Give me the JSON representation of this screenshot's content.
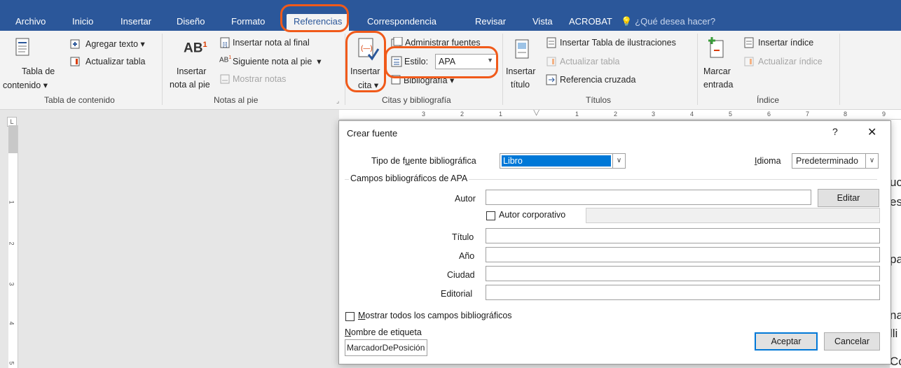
{
  "tabs": [
    "Archivo",
    "Inicio",
    "Insertar",
    "Diseño",
    "Formato",
    "Referencias",
    "Correspondencia",
    "Revisar",
    "Vista",
    "ACROBAT"
  ],
  "active_tab": "Referencias",
  "search": {
    "label": "¿Qué desea hacer?",
    "icon": "lightbulb-icon"
  },
  "ribbon": {
    "tabla_contenido": {
      "big_line1": "Tabla de",
      "big_line2": "contenido",
      "agregar_texto": "Agregar texto",
      "actualizar_tabla": "Actualizar tabla",
      "group_label": "Tabla de contenido"
    },
    "notas_pie": {
      "big_line1": "Insertar",
      "big_line2": "nota al pie",
      "insertar_nota_final": "Insertar nota al final",
      "siguiente_nota": "Siguiente nota al pie",
      "mostrar_notas": "Mostrar notas",
      "group_label": "Notas al pie"
    },
    "citas": {
      "big_line1": "Insertar",
      "big_line2": "cita",
      "administrar_fuentes": "Administrar fuentes",
      "estilo_label": "Estilo:",
      "estilo_value": "APA",
      "bibliografia": "Bibliografía",
      "group_label": "Citas y bibliografía"
    },
    "titulos": {
      "big_line1": "Insertar",
      "big_line2": "título",
      "insertar_tabla_ilustraciones": "Insertar Tabla de ilustraciones",
      "actualizar_tabla": "Actualizar tabla",
      "referencia_cruzada": "Referencia cruzada",
      "group_label": "Títulos"
    },
    "indice": {
      "big_line1": "Marcar",
      "big_line2": "entrada",
      "insertar_indice": "Insertar índice",
      "actualizar_indice": "Actualizar índice",
      "group_label": "Índice"
    }
  },
  "ruler": {
    "corner": "L",
    "h_ticks": [
      "3",
      "2",
      "1",
      "1",
      "2",
      "3",
      "4",
      "5",
      "6",
      "7",
      "8",
      "9"
    ],
    "v_ticks": [
      "1",
      "2",
      "3",
      "4",
      "5"
    ]
  },
  "page_fragments": [
    "uc",
    "es",
    "pa",
    "na",
    "lli",
    "Co"
  ],
  "dialog": {
    "title": "Crear fuente",
    "help": "?",
    "close": "✕",
    "tipo_label_pre": "Tipo de f",
    "tipo_label_u": "u",
    "tipo_label_post": "ente bibliográfica",
    "tipo_value": "Libro",
    "idioma_label_pre": "",
    "idioma_label_u": "I",
    "idioma_label_post": "dioma",
    "idioma_value": "Predeterminado",
    "section_title": "Campos bibliográficos de APA",
    "autor_label": "Autor",
    "editar_button": "Editar",
    "autor_corporativo": "Autor corporativo",
    "titulo_label": "Título",
    "anio_label": "Año",
    "ciudad_label": "Ciudad",
    "editorial_label": "Editorial",
    "mostrar_pre": "",
    "mostrar_u": "M",
    "mostrar_post": "ostrar todos los campos bibliográficos",
    "nombre_pre": "",
    "nombre_u": "N",
    "nombre_post": "ombre de etiqueta",
    "nombre_value": "MarcadorDePosición",
    "aceptar": "Aceptar",
    "cancelar": "Cancelar"
  },
  "colors": {
    "tab_bar": "#2b579a",
    "ribbon": "#f3f3f3",
    "annotation": "#f05a1a",
    "selection": "#0078d7"
  }
}
